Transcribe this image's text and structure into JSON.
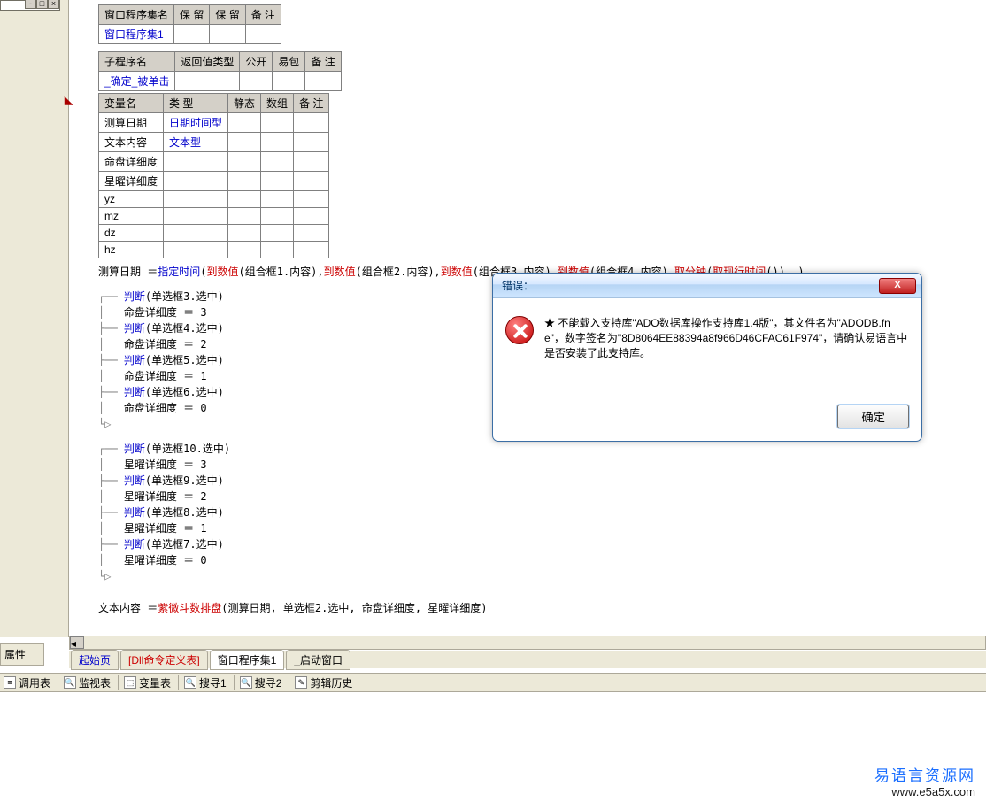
{
  "sidebar": {
    "prop_label": "属性"
  },
  "tables": {
    "t1": {
      "headers": [
        "窗口程序集名",
        "保 留",
        "保 留",
        "备 注"
      ],
      "rows": [
        [
          "窗口程序集1",
          "",
          "",
          ""
        ]
      ]
    },
    "t2": {
      "headers": [
        "子程序名",
        "返回值类型",
        "公开",
        "易包",
        "备 注"
      ],
      "rows": [
        [
          "_确定_被单击",
          "",
          "",
          "",
          ""
        ]
      ]
    },
    "t3": {
      "headers": [
        "变量名",
        "类 型",
        "静态",
        "数组",
        "备 注"
      ],
      "rows": [
        [
          "测算日期",
          "日期时间型",
          "",
          "",
          ""
        ],
        [
          "文本内容",
          "文本型",
          "",
          "",
          ""
        ],
        [
          "命盘详细度",
          "",
          "",
          "",
          ""
        ],
        [
          "星曜详细度",
          "",
          "",
          "",
          ""
        ],
        [
          "yz",
          "",
          "",
          "",
          ""
        ],
        [
          "mz",
          "",
          "",
          "",
          ""
        ],
        [
          "dz",
          "",
          "",
          "",
          ""
        ],
        [
          "hz",
          "",
          "",
          "",
          ""
        ]
      ]
    }
  },
  "code": {
    "l1": {
      "a": "测算日期 ＝ ",
      "b": "指定时间",
      "c": " (",
      "d": "到数值",
      "e": " (组合框1.内容), ",
      "f": "到数值",
      "g": " (组合框2.内容), ",
      "h": "到数值",
      "i": " (组合框3.内容), ",
      "j": "到数值",
      "k": " (组合框4.内容), ",
      "l": "取分钟",
      "m": " (",
      "n": "取现行时间",
      "o": " ()), )"
    },
    "blk1": [
      {
        "t": "j",
        "txt": "判断",
        "arg": " (单选框3.选中)"
      },
      {
        "t": "a",
        "txt": "命盘详细度 ＝ 3"
      },
      {
        "t": "j",
        "txt": "判断",
        "arg": " (单选框4.选中)"
      },
      {
        "t": "a",
        "txt": "命盘详细度 ＝ 2"
      },
      {
        "t": "j",
        "txt": "判断",
        "arg": " (单选框5.选中)"
      },
      {
        "t": "a",
        "txt": "命盘详细度 ＝ 1"
      },
      {
        "t": "j",
        "txt": "判断",
        "arg": " (单选框6.选中)"
      },
      {
        "t": "a",
        "txt": "命盘详细度 ＝ 0"
      }
    ],
    "blk2": [
      {
        "t": "j",
        "txt": "判断",
        "arg": " (单选框10.选中)"
      },
      {
        "t": "a",
        "txt": "星曜详细度 ＝ 3"
      },
      {
        "t": "j",
        "txt": "判断",
        "arg": " (单选框9.选中)"
      },
      {
        "t": "a",
        "txt": "星曜详细度 ＝ 2"
      },
      {
        "t": "j",
        "txt": "判断",
        "arg": " (单选框8.选中)"
      },
      {
        "t": "a",
        "txt": "星曜详细度 ＝ 1"
      },
      {
        "t": "j",
        "txt": "判断",
        "arg": " (单选框7.选中)"
      },
      {
        "t": "a",
        "txt": "星曜详细度 ＝ 0"
      }
    ],
    "last": {
      "a": "文本内容 ＝ ",
      "b": "紫微斗数排盘",
      "c": " (测算日期, 单选框2.选中, 命盘详细度, 星曜详细度)"
    }
  },
  "tabs": [
    {
      "label": "起始页",
      "cls": "colored1"
    },
    {
      "label": "[Dll命令定义表]",
      "cls": "colored2"
    },
    {
      "label": "窗口程序集1",
      "cls": "active"
    },
    {
      "label": "_启动窗口",
      "cls": ""
    }
  ],
  "toolbar": [
    {
      "icon": "≡",
      "label": "调用表"
    },
    {
      "icon": "🔍",
      "label": "监视表"
    },
    {
      "icon": "⬚",
      "label": "变量表"
    },
    {
      "icon": "🔍",
      "label": "搜寻1"
    },
    {
      "icon": "🔍",
      "label": "搜寻2"
    },
    {
      "icon": "✎",
      "label": "剪辑历史"
    }
  ],
  "dialog": {
    "title": "错误：",
    "text": "★ 不能载入支持库\"ADO数据库操作支持库1.4版\"，其文件名为\"ADODB.fne\"，数字签名为\"8D8064EE88394a8f966D46CFAC61F974\"，请确认易语言中是否安装了此支持库。",
    "ok": "确定",
    "close": "X"
  },
  "watermark": {
    "l1": "易语言资源网",
    "l2": "www.e5a5x.com"
  }
}
